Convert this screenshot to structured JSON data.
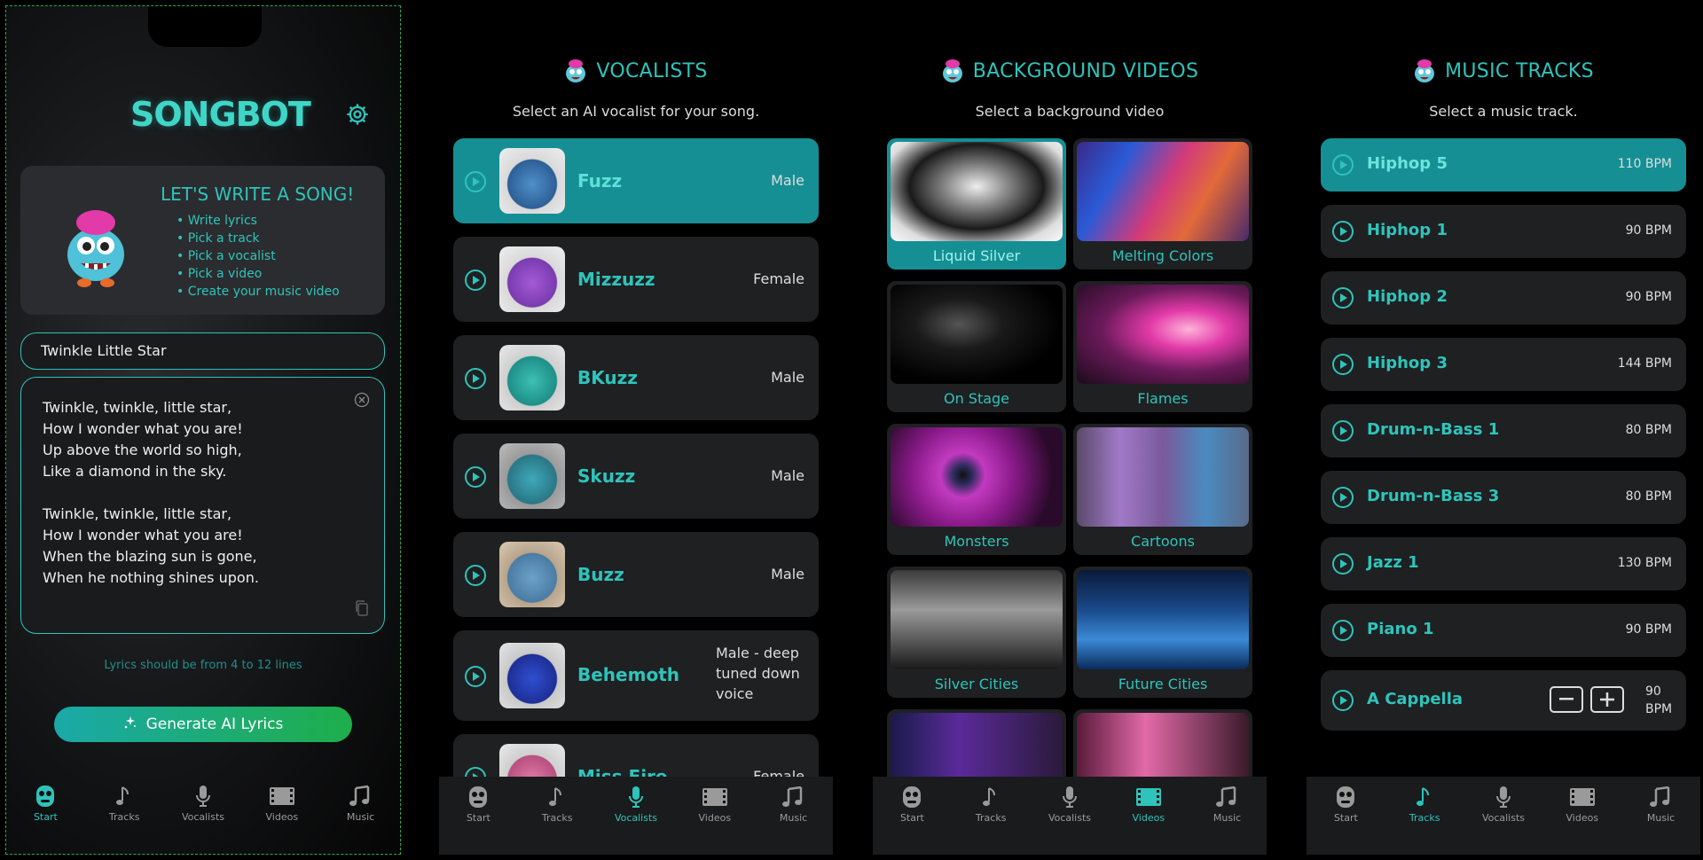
{
  "tabs": [
    {
      "label": "Start",
      "icon": "robot-icon"
    },
    {
      "label": "Tracks",
      "icon": "music-note-icon"
    },
    {
      "label": "Vocalists",
      "icon": "microphone-icon"
    },
    {
      "label": "Videos",
      "icon": "film-icon"
    },
    {
      "label": "Music",
      "icon": "music-notes-icon"
    }
  ],
  "start": {
    "logo": "SONGBOT",
    "intro_title": "LET'S WRITE A SONG!",
    "steps": [
      "Write lyrics",
      "Pick a track",
      "Pick a vocalist",
      "Pick a video",
      "Create your music video"
    ],
    "song_title": "Twinkle Little Star",
    "lyrics_verse1": [
      "Twinkle, twinkle, little star,",
      "How I wonder what you are!",
      "Up above the world so high,",
      "Like a diamond in the sky."
    ],
    "lyrics_verse2": [
      "Twinkle, twinkle, little star,",
      "How I wonder what you are!",
      "When the blazing sun is gone,",
      "When he nothing shines upon."
    ],
    "hint": "Lyrics should be from 4 to 12 lines",
    "generate_label": "Generate AI Lyrics"
  },
  "vocalists": {
    "title": "VOCALISTS",
    "subtitle": "Select an AI vocalist for your song.",
    "items": [
      {
        "name": "Fuzz",
        "voice": "Male"
      },
      {
        "name": "Mizzuzz",
        "voice": "Female"
      },
      {
        "name": "BKuzz",
        "voice": "Male"
      },
      {
        "name": "Skuzz",
        "voice": "Male"
      },
      {
        "name": "Buzz",
        "voice": "Male"
      },
      {
        "name": "Behemoth",
        "voice": "Male - deep tuned down voice"
      },
      {
        "name": "Miss Fire",
        "voice": "Female"
      }
    ]
  },
  "videos": {
    "title": "BACKGROUND VIDEOS",
    "subtitle": "Select a background video",
    "items": [
      "Liquid Silver",
      "Melting Colors",
      "On Stage",
      "Flames",
      "Monsters",
      "Cartoons",
      "Silver Cities",
      "Future Cities"
    ]
  },
  "tracks": {
    "title": "MUSIC TRACKS",
    "subtitle": "Select a music track.",
    "items": [
      {
        "name": "Hiphop 5",
        "bpm": "110 BPM"
      },
      {
        "name": "Hiphop 1",
        "bpm": "90 BPM"
      },
      {
        "name": "Hiphop 2",
        "bpm": "90 BPM"
      },
      {
        "name": "Hiphop 3",
        "bpm": "144 BPM"
      },
      {
        "name": "Drum-n-Bass 1",
        "bpm": "80 BPM"
      },
      {
        "name": "Drum-n-Bass 3",
        "bpm": "80 BPM"
      },
      {
        "name": "Jazz 1",
        "bpm": "130 BPM"
      },
      {
        "name": "Piano 1",
        "bpm": "90 BPM"
      },
      {
        "name": "A Cappella",
        "bpm": "90 BPM"
      }
    ]
  },
  "colors": {
    "accent": "#2ec4bb",
    "selected": "#168f94",
    "card": "#1f2022"
  }
}
